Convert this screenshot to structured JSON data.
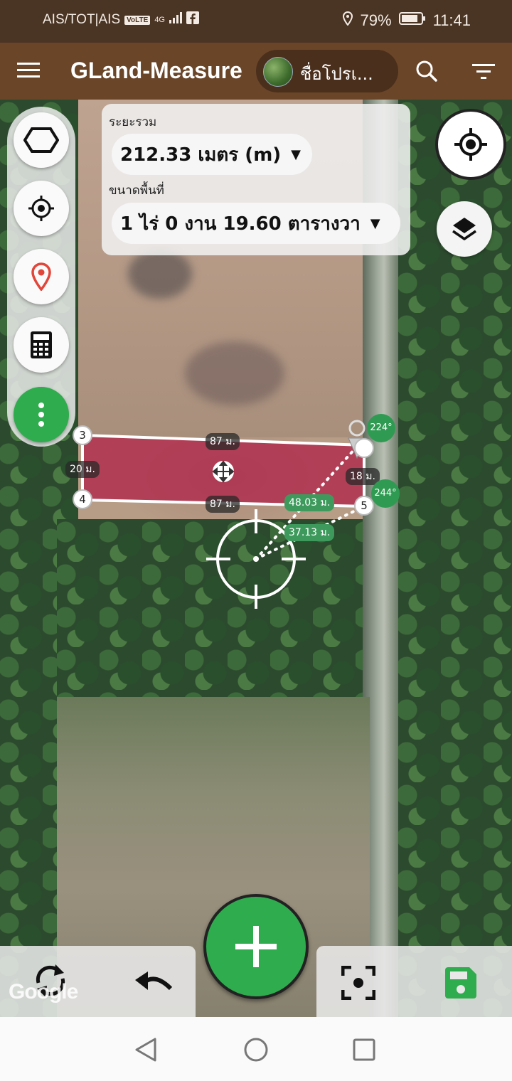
{
  "status_bar": {
    "carrier": "AIS/TOT|AIS",
    "volte": "VoLTE",
    "network": "4G",
    "battery": "79%",
    "time": "11:41"
  },
  "toolbar": {
    "title": "GLand-Measure",
    "project_name": "ชื่อโปรเ..."
  },
  "info": {
    "distance_label": "ระยะรวม",
    "distance_value": "212.33 เมตร (m)",
    "area_label": "ขนาดพื้นที่",
    "area_value": "1 ไร่ 0 งาน 19.60 ตารางวา"
  },
  "map": {
    "vertices": [
      "3",
      "4",
      "5"
    ],
    "edge_labels": {
      "top": "87 ม.",
      "bottom": "87 ม.",
      "left": "20 ม.",
      "right": "18 ม."
    },
    "dist_labels": [
      "48.03 ม.",
      "37.13 ม."
    ],
    "bearings": [
      "224°",
      "244°"
    ],
    "attribution": "Google"
  },
  "colors": {
    "accent": "#2fac4d",
    "toolbar": "#6a4528",
    "statusbar": "#4a3424",
    "polygon_fill": "#b0264a"
  }
}
